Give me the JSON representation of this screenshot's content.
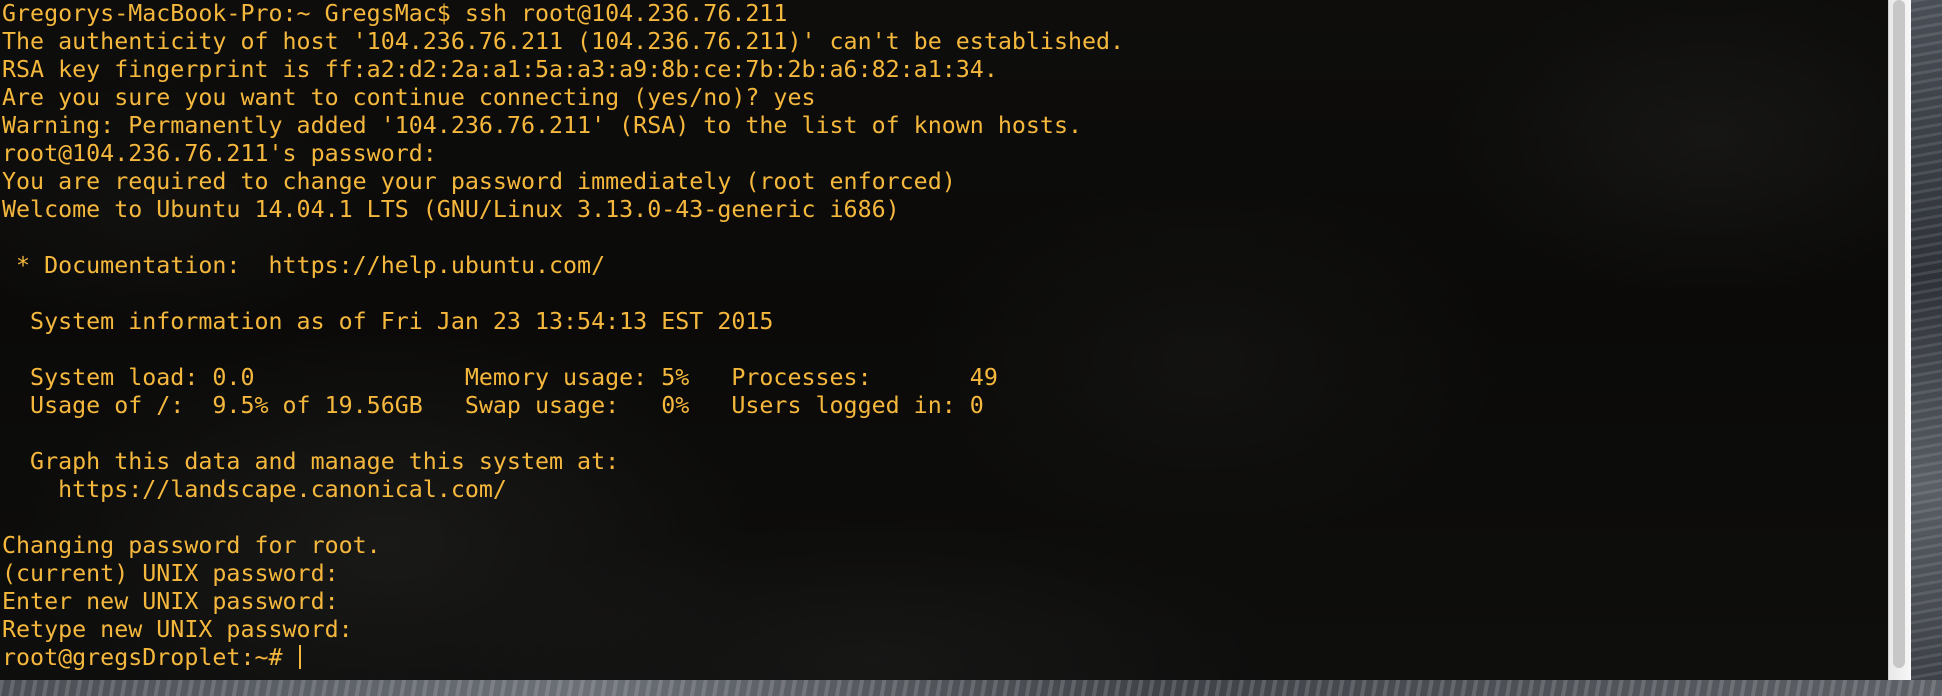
{
  "terminal": {
    "lines": [
      "Gregorys-MacBook-Pro:~ GregsMac$ ssh root@104.236.76.211",
      "The authenticity of host '104.236.76.211 (104.236.76.211)' can't be established.",
      "RSA key fingerprint is ff:a2:d2:2a:a1:5a:a3:a9:8b:ce:7b:2b:a6:82:a1:34.",
      "Are you sure you want to continue connecting (yes/no)? yes",
      "Warning: Permanently added '104.236.76.211' (RSA) to the list of known hosts.",
      "root@104.236.76.211's password:",
      "You are required to change your password immediately (root enforced)",
      "Welcome to Ubuntu 14.04.1 LTS (GNU/Linux 3.13.0-43-generic i686)",
      "",
      " * Documentation:  https://help.ubuntu.com/",
      "",
      "  System information as of Fri Jan 23 13:54:13 EST 2015",
      "",
      "  System load: 0.0               Memory usage: 5%   Processes:       49",
      "  Usage of /:  9.5% of 19.56GB   Swap usage:   0%   Users logged in: 0",
      "",
      "  Graph this data and manage this system at:",
      "    https://landscape.canonical.com/",
      "",
      "Changing password for root.",
      "(current) UNIX password:",
      "Enter new UNIX password:",
      "Retype new UNIX password:"
    ],
    "prompt": "root@gregsDroplet:~# ",
    "text_color": "#f5b83d"
  }
}
